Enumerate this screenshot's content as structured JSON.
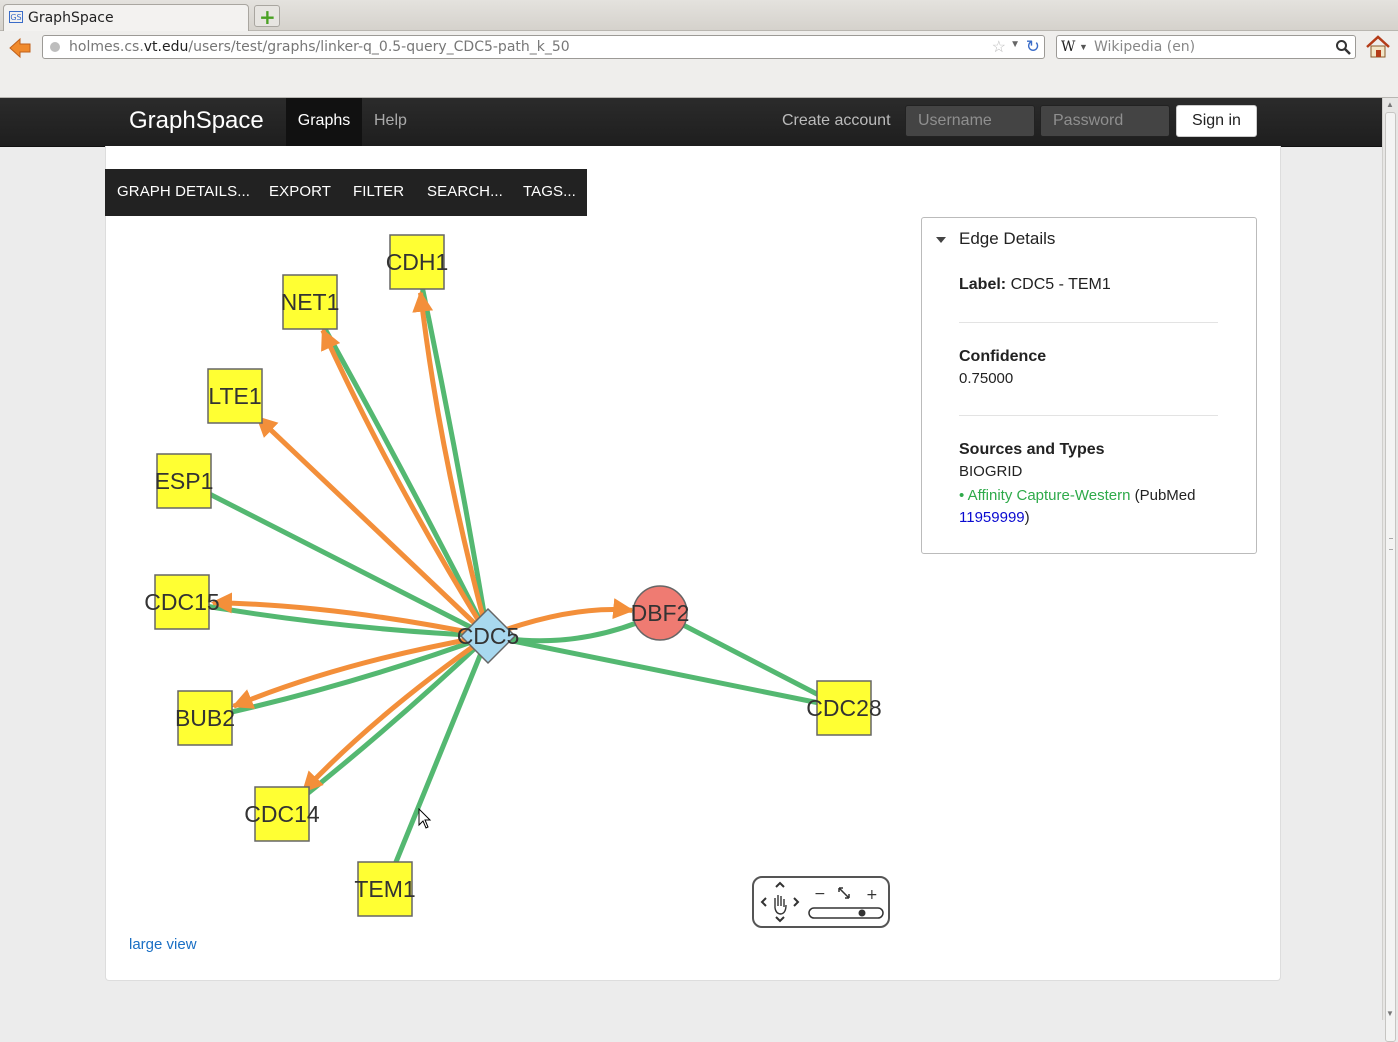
{
  "browser": {
    "tab_title": "GraphSpace",
    "tab_icon_label": "GS",
    "url_host_prefix": "holmes.cs.",
    "url_host_main": "vt.edu",
    "url_path": "/users/test/graphs/linker-q_0.5-query_CDC5-path_k_50",
    "search_engine": "W",
    "search_placeholder": "Wikipedia (en)"
  },
  "topnav": {
    "brand": "GraphSpace",
    "graphs": "Graphs",
    "help": "Help",
    "create_account": "Create account",
    "username_placeholder": "Username",
    "password_placeholder": "Password",
    "sign_in": "Sign in"
  },
  "toolbar": {
    "details": "GRAPH DETAILS...",
    "export": "EXPORT",
    "filter": "FILTER",
    "search": "SEARCH...",
    "tags": "TAGS..."
  },
  "graph": {
    "colors": {
      "edge_green": "#54b871",
      "edge_orange": "#f38f3a",
      "node_yellow": "#ffff33",
      "node_query": "#a8d8ef",
      "node_red": "#ef7b72"
    },
    "nodes": [
      {
        "id": "CDH1",
        "label": "CDH1",
        "shape": "square"
      },
      {
        "id": "NET1",
        "label": "NET1",
        "shape": "square"
      },
      {
        "id": "LTE1",
        "label": "LTE1",
        "shape": "square"
      },
      {
        "id": "ESP1",
        "label": "ESP1",
        "shape": "square"
      },
      {
        "id": "CDC15",
        "label": "CDC15",
        "shape": "square"
      },
      {
        "id": "BUB2",
        "label": "BUB2",
        "shape": "square"
      },
      {
        "id": "CDC14",
        "label": "CDC14",
        "shape": "square"
      },
      {
        "id": "TEM1",
        "label": "TEM1",
        "shape": "square"
      },
      {
        "id": "CDC5",
        "label": "CDC5",
        "shape": "diamond"
      },
      {
        "id": "DBF2",
        "label": "DBF2",
        "shape": "circle"
      },
      {
        "id": "CDC28",
        "label": "CDC28",
        "shape": "square"
      }
    ],
    "edges": [
      {
        "source": "CDC5",
        "target": "CDH1",
        "type": "undirected"
      },
      {
        "source": "CDC5",
        "target": "CDH1",
        "type": "directed"
      },
      {
        "source": "CDC5",
        "target": "NET1",
        "type": "undirected"
      },
      {
        "source": "CDC5",
        "target": "NET1",
        "type": "directed"
      },
      {
        "source": "CDC5",
        "target": "LTE1",
        "type": "directed"
      },
      {
        "source": "CDC5",
        "target": "ESP1",
        "type": "undirected"
      },
      {
        "source": "CDC5",
        "target": "CDC15",
        "type": "undirected"
      },
      {
        "source": "CDC5",
        "target": "CDC15",
        "type": "directed"
      },
      {
        "source": "CDC5",
        "target": "BUB2",
        "type": "undirected"
      },
      {
        "source": "CDC5",
        "target": "BUB2",
        "type": "directed"
      },
      {
        "source": "CDC5",
        "target": "CDC14",
        "type": "undirected"
      },
      {
        "source": "CDC5",
        "target": "CDC14",
        "type": "directed"
      },
      {
        "source": "CDC5",
        "target": "TEM1",
        "type": "undirected"
      },
      {
        "source": "CDC5",
        "target": "DBF2",
        "type": "undirected"
      },
      {
        "source": "CDC5",
        "target": "DBF2",
        "type": "directed"
      },
      {
        "source": "CDC5",
        "target": "CDC28",
        "type": "undirected"
      },
      {
        "source": "DBF2",
        "target": "CDC28",
        "type": "undirected"
      }
    ]
  },
  "large_view": "large view",
  "edge_details": {
    "title": "Edge Details",
    "label_key": "Label:",
    "label_value": "CDC5 - TEM1",
    "confidence_key": "Confidence",
    "confidence_value": "0.75000",
    "sources_key": "Sources and Types",
    "source_db": "BIOGRID",
    "source_type": "• Affinity Capture-Western",
    "pubmed_prefix": "(PubMed",
    "pubmed_id": "11959999",
    "pubmed_suffix": ")"
  }
}
